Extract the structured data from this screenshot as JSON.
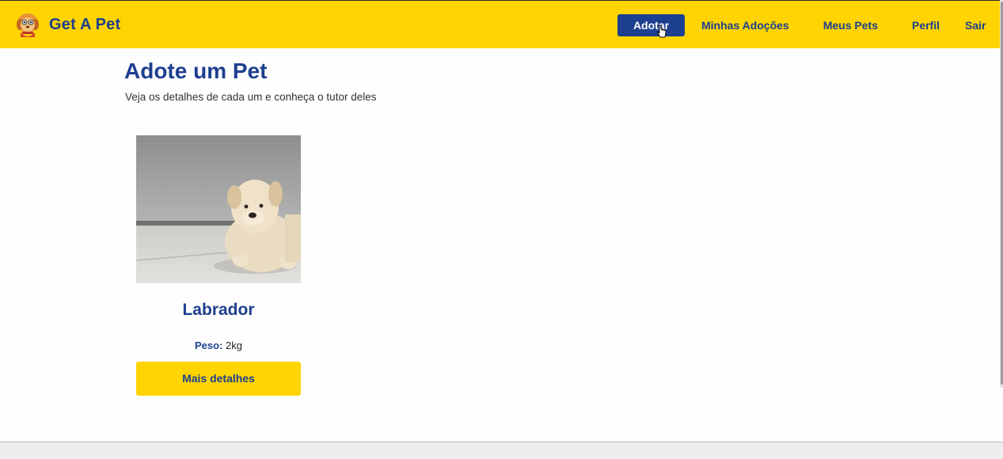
{
  "brand": {
    "name": "Get A Pet",
    "logo_icon": "dog-logo-icon"
  },
  "nav": {
    "items": [
      {
        "label": "Adotar",
        "active": true
      },
      {
        "label": "Minhas Adoções",
        "active": false
      },
      {
        "label": "Meus Pets",
        "active": false
      },
      {
        "label": "Perfil",
        "active": false
      },
      {
        "label": "Sair",
        "active": false
      }
    ]
  },
  "page": {
    "title": "Adote um Pet",
    "subtitle": "Veja os detalhes de cada um e conheça o tutor deles"
  },
  "pets": [
    {
      "name": "Labrador",
      "weight_label": "Peso:",
      "weight_value": "2kg",
      "button_label": "Mais detalhes",
      "photo": "labrador-puppy-photo"
    }
  ],
  "colors": {
    "navbar_bg": "#ffd400",
    "primary": "#1d3f8f",
    "active_text": "#ffffff"
  }
}
